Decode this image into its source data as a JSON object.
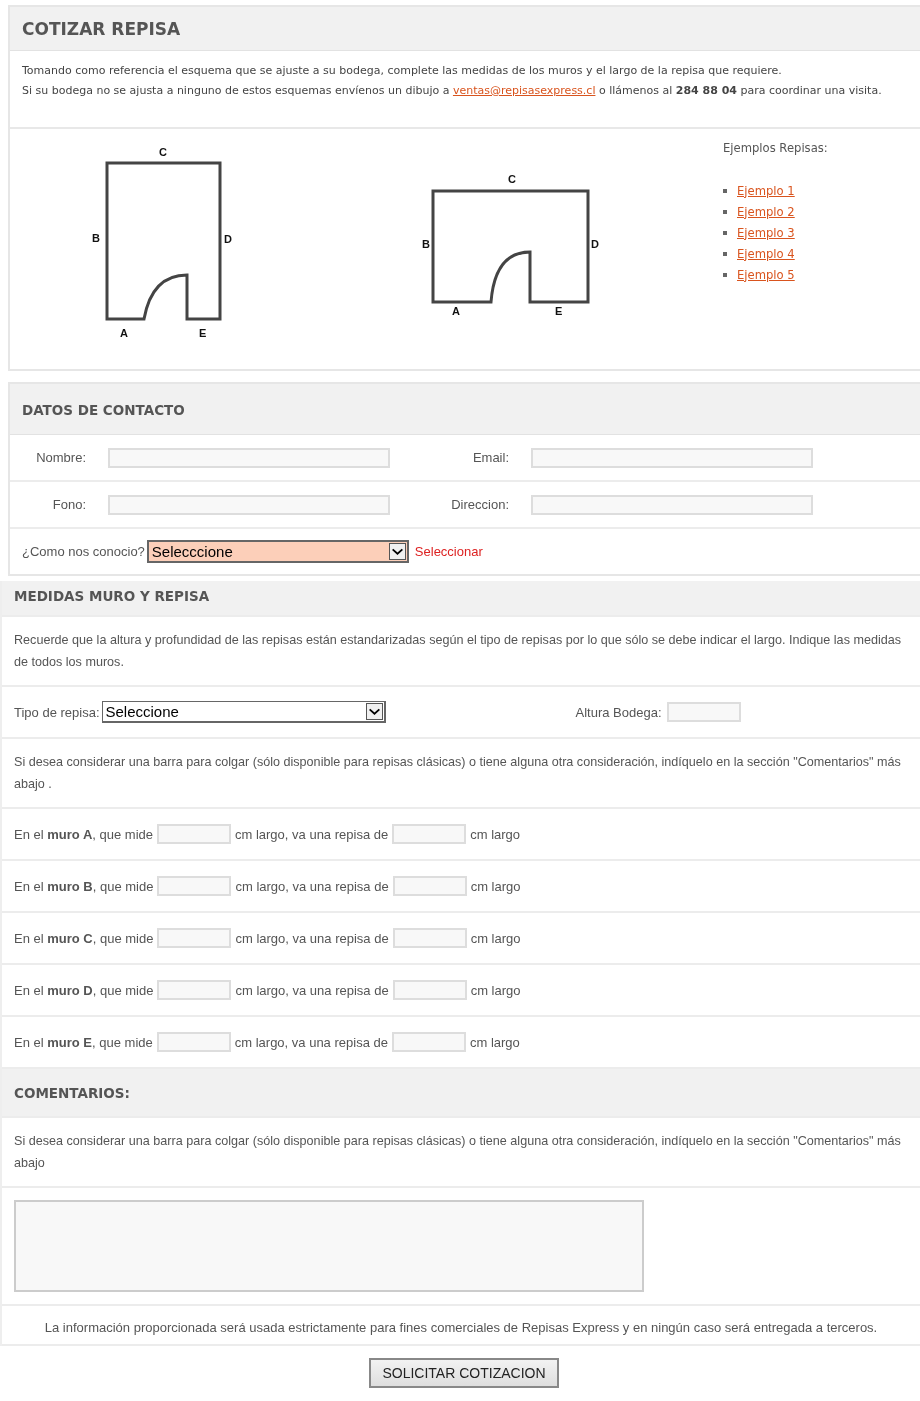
{
  "cotizar": {
    "title": "COTIZAR REPISA",
    "intro_line_1": "Tomando como referencia el esquema que se ajuste a su bodega, complete las medidas de los muros y el largo de la repisa que requiere.",
    "intro_line_2_before": "Si su bodega no se ajusta a ninguno de estos esquemas envíenos un dibujo a",
    "email_link": "ventas@repisasexpress.cl",
    "intro_line_2_after": "o llámenos al **284 88 04** para coordinar una visita.",
    "diagrams": [
      {
        "kind": "tall",
        "labels": [
          "A",
          "B",
          "C",
          "D",
          "E"
        ]
      },
      {
        "kind": "wide",
        "labels": [
          "A",
          "B",
          "C",
          "D",
          "E"
        ]
      }
    ],
    "examples_title": "Ejemplos Repisas:",
    "examples": [
      "Ejemplo 1",
      "Ejemplo 2",
      "Ejemplo 3",
      "Ejemplo 4",
      "Ejemplo 5"
    ]
  },
  "contacto": {
    "title": "DATOS DE CONTACTO",
    "fields": [
      {
        "label": "Nombre:"
      },
      {
        "label": "Email:"
      },
      {
        "label": "Fono:"
      },
      {
        "label": "Direccion:"
      }
    ],
    "source_label": "¿Como nos conocio?",
    "source_value": "Selecccione",
    "source_invalid": true,
    "source_error": "Seleccionar"
  },
  "medidas": {
    "title": "MEDIDAS MURO Y REPISA",
    "note": "Recuerde que la altura y profundidad de las repisas están estandarizadas según el tipo de repisas por lo que sólo se debe indicar el largo. Indique las medidas de todos los muros.",
    "tipo_label": "Tipo de repisa:",
    "tipo_value": "Seleccione",
    "altura_label": "Altura Bodega:",
    "barra_note": "Si desea considerar una barra para colgar (sólo disponible para repisas clásicas) o tiene alguna otra consideración, indíquelo en la sección \"Comentarios\" más abajo .",
    "walls": [
      {
        "prefix": "En el **muro A**, que mide",
        "middle": "cm largo, va una repisa de",
        "suffix": "cm largo"
      },
      {
        "prefix": "En el **muro B**, que mide",
        "middle": "cm largo, va una repisa de",
        "suffix": "cm largo"
      },
      {
        "prefix": "En el **muro C**, que mide",
        "middle": "cm largo, va una repisa de",
        "suffix": "cm largo"
      },
      {
        "prefix": "En el **muro D**, que mide",
        "middle": "cm largo, va una repisa de",
        "suffix": "cm largo"
      },
      {
        "prefix": "En el **muro E**, que mide",
        "middle": "cm largo, va una repisa de",
        "suffix": "cm largo"
      }
    ]
  },
  "comentarios": {
    "title": "COMENTARIOS:",
    "note": "Si desea considerar una barra para colgar (sólo disponible para repisas clásicas) o tiene alguna otra consideración, indíquelo en la sección \"Comentarios\" más abajo"
  },
  "privacy": "La información proporcionada será usada estrictamente para fines comerciales de Repisas Express y en ningún caso será entregada a terceros.",
  "submit": "SOLICITAR COTIZACION"
}
